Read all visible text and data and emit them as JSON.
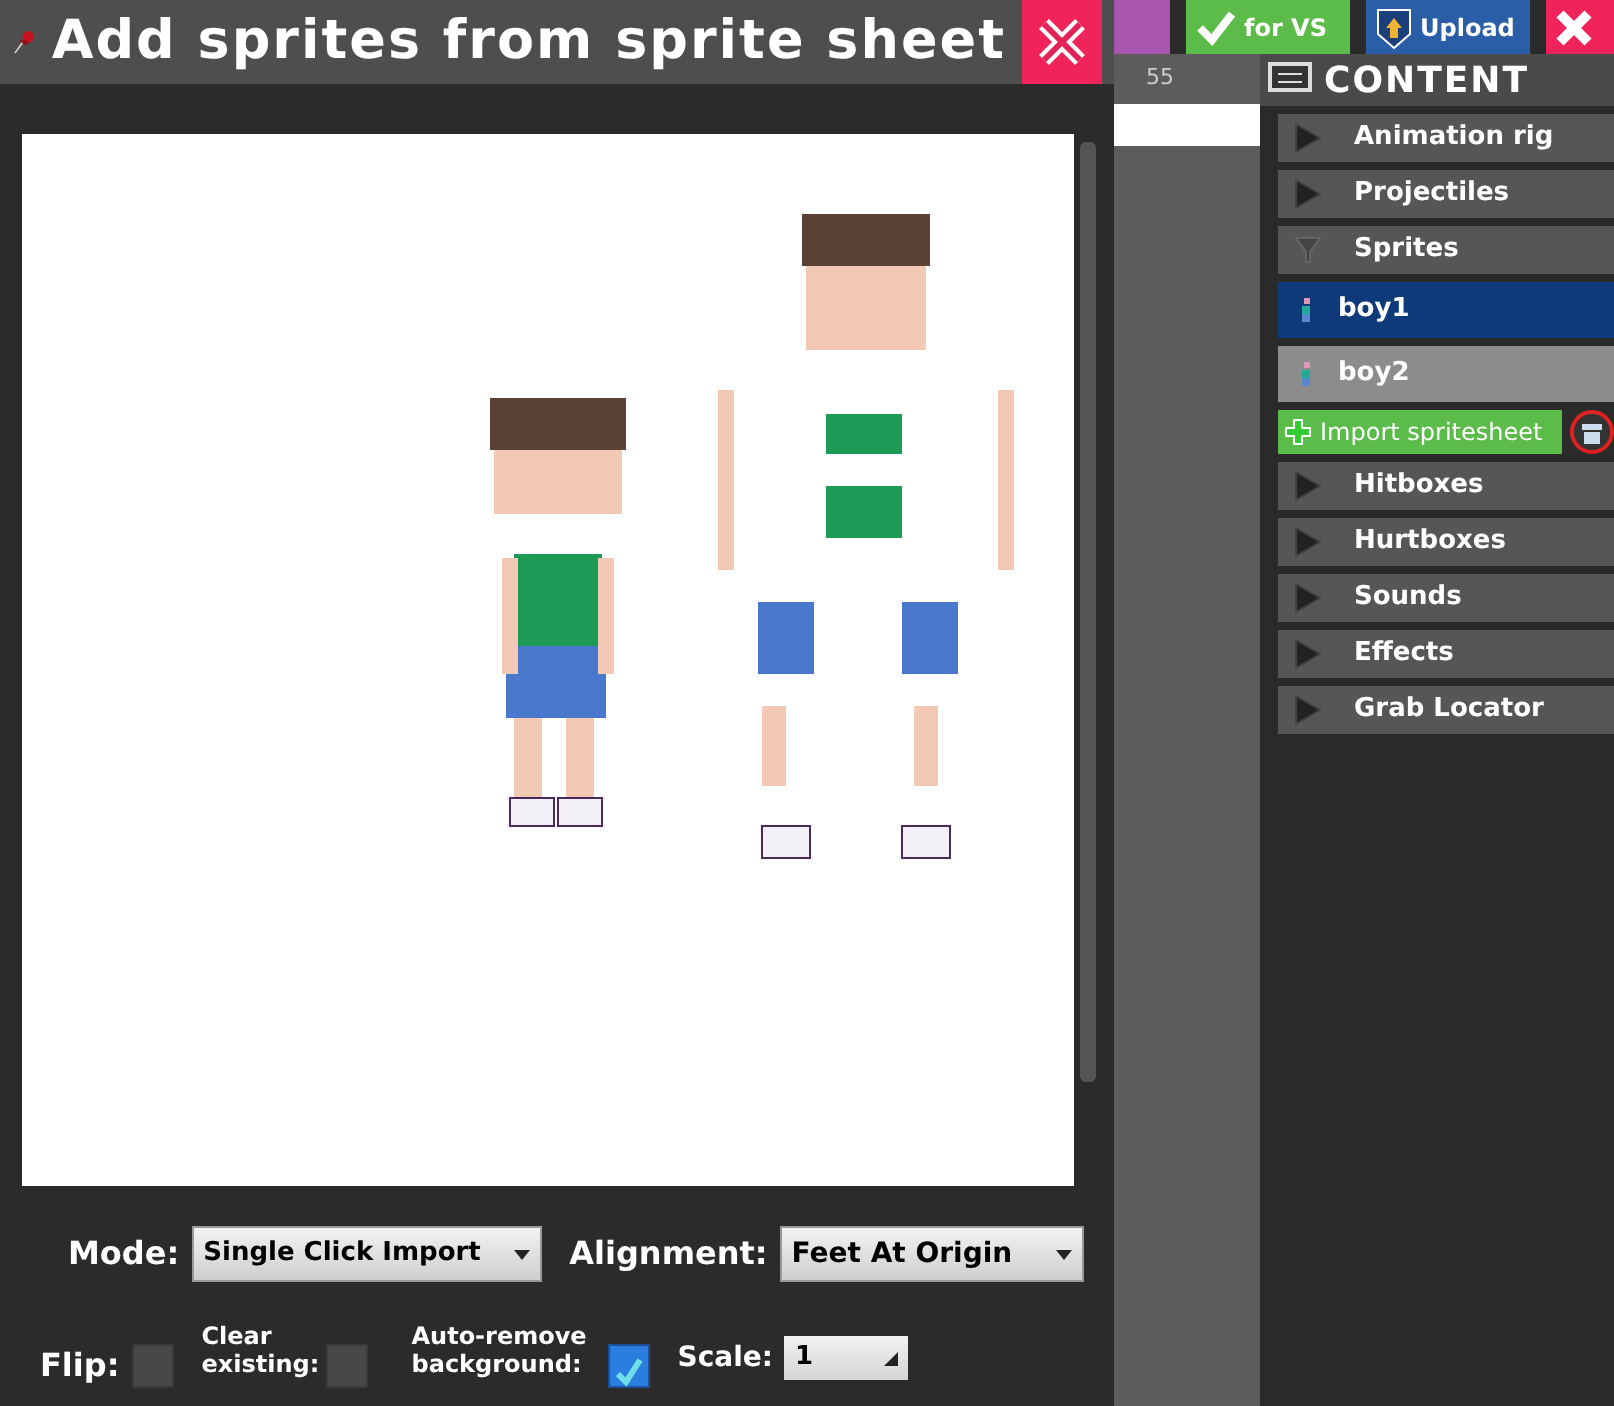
{
  "dialog": {
    "title": "Add sprites from sprite sheet",
    "controls": {
      "mode_label": "Mode:",
      "mode_value": "Single Click Import",
      "alignment_label": "Alignment:",
      "alignment_value": "Feet At Origin",
      "flip_label": "Flip:",
      "flip_checked": false,
      "clear_label": "Clear existing:",
      "clear_checked": false,
      "autoremove_label": "Auto-remove background:",
      "autoremove_checked": true,
      "scale_label": "Scale:",
      "scale_value": "1"
    }
  },
  "toolbar": {
    "buttons": [
      {
        "kind": "purple"
      },
      {
        "kind": "check",
        "label": "for VS"
      },
      {
        "kind": "upload",
        "label": "Upload"
      },
      {
        "kind": "close"
      }
    ]
  },
  "ruler": {
    "number": "55"
  },
  "content": {
    "title": "CONTENT",
    "items": [
      {
        "label": "Animation rig",
        "expanded": false
      },
      {
        "label": "Projectiles",
        "expanded": false
      },
      {
        "label": "Sprites",
        "expanded": true,
        "children": [
          {
            "label": "boy1",
            "selected": true
          },
          {
            "label": "boy2",
            "selected": false
          }
        ],
        "action": "Import spritesheet"
      },
      {
        "label": "Hitboxes",
        "expanded": false
      },
      {
        "label": "Hurtboxes",
        "expanded": false
      },
      {
        "label": "Sounds",
        "expanded": false
      },
      {
        "label": "Effects",
        "expanded": false
      },
      {
        "label": "Grab Locator",
        "expanded": false
      }
    ]
  }
}
